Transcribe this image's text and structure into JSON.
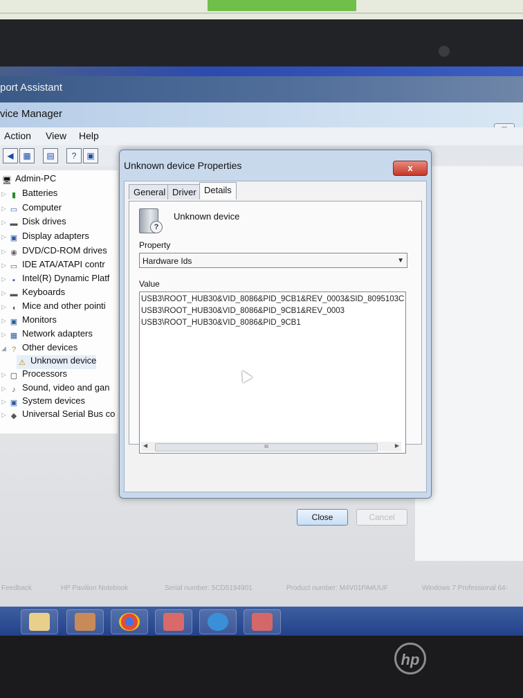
{
  "support_assistant": {
    "title": "port Assistant"
  },
  "device_manager": {
    "title": "vice Manager",
    "menu": [
      "Action",
      "View",
      "Help"
    ],
    "minimize_glyph": "▭",
    "tree": [
      {
        "label": "Admin-PC",
        "icon": "computer-icon"
      },
      {
        "label": "Batteries",
        "icon": "battery-icon"
      },
      {
        "label": "Computer",
        "icon": "computer-icon"
      },
      {
        "label": "Disk drives",
        "icon": "disk-icon"
      },
      {
        "label": "Display adapters",
        "icon": "display-icon"
      },
      {
        "label": "DVD/CD-ROM drives",
        "icon": "dvd-icon"
      },
      {
        "label": "IDE ATA/ATAPI contr",
        "icon": "ide-icon"
      },
      {
        "label": "Intel(R) Dynamic Platf",
        "icon": "chip-icon"
      },
      {
        "label": "Keyboards",
        "icon": "keyboard-icon"
      },
      {
        "label": "Mice and other pointi",
        "icon": "mouse-icon"
      },
      {
        "label": "Monitors",
        "icon": "monitor-icon"
      },
      {
        "label": "Network adapters",
        "icon": "network-icon"
      },
      {
        "label": "Other devices",
        "icon": "other-devices-icon"
      },
      {
        "label": "Unknown device",
        "icon": "unknown-device-icon"
      },
      {
        "label": "Processors",
        "icon": "processor-icon"
      },
      {
        "label": "Sound, video and gan",
        "icon": "sound-icon"
      },
      {
        "label": "System devices",
        "icon": "system-icon"
      },
      {
        "label": "Universal Serial Bus co",
        "icon": "usb-icon"
      }
    ]
  },
  "dialog": {
    "title": "Unknown device Properties",
    "close_glyph": "x",
    "tabs": [
      "General",
      "Driver",
      "Details"
    ],
    "active_tab": "Details",
    "device_name": "Unknown device",
    "device_icon_glyph": "?",
    "property_label": "Property",
    "property_value": "Hardware Ids",
    "value_label": "Value",
    "values": [
      "USB3\\ROOT_HUB30&VID_8086&PID_9CB1&REV_0003&SID_8095103C",
      "USB3\\ROOT_HUB30&VID_8086&PID_9CB1&REV_0003",
      "USB3\\ROOT_HUB30&VID_8086&PID_9CB1"
    ],
    "scroll_thumb_glyph": "III",
    "buttons": {
      "close": "Close",
      "cancel": "Cancel"
    }
  },
  "footer": {
    "items": [
      "Feedback",
      "HP Pavilion Notebook",
      "Serial number: 5CD5194901",
      "Product number: M4V01PA#UUF",
      "Windows 7 Professional 64-"
    ]
  },
  "colors": {
    "accent": "#3b5a88",
    "close_red": "#c7382a",
    "dialog_frame": "#c9d9ec"
  }
}
